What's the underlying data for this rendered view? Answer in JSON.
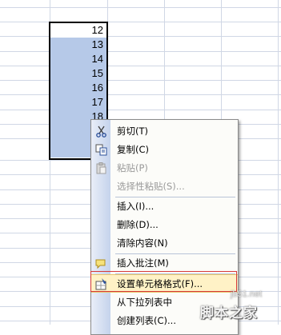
{
  "cells": {
    "values": [
      "12",
      "13",
      "14",
      "15",
      "16",
      "17",
      "18",
      "",
      ""
    ]
  },
  "context_menu": {
    "items": [
      {
        "label": "剪切(T)",
        "icon": "cut-icon",
        "disabled": false
      },
      {
        "label": "复制(C)",
        "icon": "copy-icon",
        "disabled": false
      },
      {
        "label": "粘贴(P)",
        "icon": "paste-icon",
        "disabled": true
      },
      {
        "label": "选择性粘贴(S)...",
        "icon": "",
        "disabled": true
      },
      {
        "label": "插入(I)...",
        "icon": "",
        "disabled": false
      },
      {
        "label": "删除(D)...",
        "icon": "",
        "disabled": false
      },
      {
        "label": "清除内容(N)",
        "icon": "",
        "disabled": false
      },
      {
        "label": "插入批注(M)",
        "icon": "comment-icon",
        "disabled": false
      },
      {
        "label": "设置单元格格式(F)...",
        "icon": "format-cells-icon",
        "disabled": false,
        "highlighted": true
      },
      {
        "label": "从下拉列表中",
        "icon": "",
        "disabled": false
      },
      {
        "label": "创建列表(C)...",
        "icon": "",
        "disabled": false
      }
    ]
  },
  "watermark": {
    "url": "jb51.net",
    "text": "脚本之家"
  },
  "colors": {
    "selection": "#b6c9e8",
    "highlight_box": "#d63a3a",
    "menu_gutter": "#c5d3ec"
  }
}
